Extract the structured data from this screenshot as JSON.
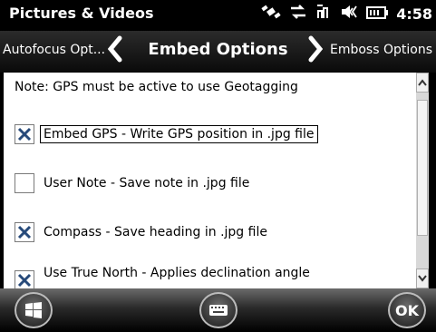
{
  "statusbar": {
    "title": "Pictures & Videos",
    "time": "4:58"
  },
  "navbar": {
    "prev_label": "Autofocus Opt...",
    "title": "Embed Options",
    "next_label": "Emboss Options"
  },
  "content": {
    "note": "Note: GPS must be active to use Geotagging",
    "options": [
      {
        "label": "Embed GPS - Write GPS position in .jpg file",
        "checked": true
      },
      {
        "label": "User Note - Save note in .jpg file",
        "checked": false
      },
      {
        "label": "Compass - Save heading in .jpg file",
        "checked": true
      },
      {
        "label": "Use True North - Applies declination angle",
        "checked": true
      }
    ]
  },
  "softkeys": {
    "start_icon": "windows-logo-icon",
    "keyboard_icon": "keyboard-icon",
    "ok_label": "OK"
  }
}
